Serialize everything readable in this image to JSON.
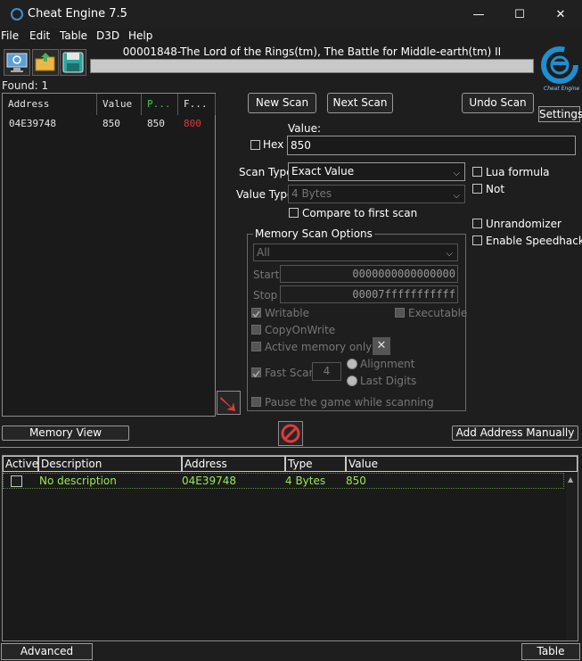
{
  "window": {
    "title": "Cheat Engine 7.5",
    "minimize_glyph": "—",
    "maximize_glyph": "☐",
    "close_glyph": "✕"
  },
  "menu": [
    "File",
    "Edit",
    "Table",
    "D3D",
    "Help"
  ],
  "process_title": "00001848-The Lord of the Rings(tm), The Battle for Middle-earth(tm) II",
  "found_label": "Found: 1",
  "results": {
    "headers": [
      "Address",
      "Value",
      "P...",
      "F..."
    ],
    "rows": [
      {
        "address": "04E39748",
        "value": "850",
        "previous": "850",
        "first": "800"
      }
    ]
  },
  "buttons": {
    "new_scan": "New Scan",
    "next_scan": "Next Scan",
    "undo_scan": "Undo Scan",
    "settings": "Settings",
    "memory_view": "Memory View",
    "add_address": "Add Address Manually",
    "advanced_options": "Advanced Options",
    "table_extras": "Table Extras"
  },
  "scan": {
    "value_label": "Value:",
    "hex_label": "Hex",
    "value": "850",
    "scan_type_label": "Scan Type",
    "scan_type": "Exact Value",
    "value_type_label": "Value Type",
    "value_type": "4 Bytes",
    "compare_first": "Compare to first scan",
    "lua_formula": "Lua formula",
    "not_label": "Not",
    "unrandomizer": "Unrandomizer",
    "speedhack": "Enable Speedhack"
  },
  "memory_options": {
    "title": "Memory Scan Options",
    "region": "All",
    "start_label": "Start",
    "start": "0000000000000000",
    "stop_label": "Stop",
    "stop": "00007fffffffffff",
    "writable": "Writable",
    "executable": "Executable",
    "copy_on_write": "CopyOnWrite",
    "active_memory": "Active memory only",
    "fast_scan": "Fast Scan",
    "fast_scan_value": "4",
    "alignment": "Alignment",
    "last_digits": "Last Digits",
    "pause_game": "Pause the game while scanning"
  },
  "address_list": {
    "headers": [
      "Active",
      "Description",
      "Address",
      "Type",
      "Value"
    ],
    "rows": [
      {
        "description": "No description",
        "address": "04E39748",
        "type": "4 Bytes",
        "value": "850"
      }
    ]
  },
  "logo_text": "Cheat Engine",
  "colors": {
    "accent": "#1e8fd0",
    "found_text": "#9be65a",
    "changed_value": "#e03a3a",
    "stop_icon": "#e03a3a"
  }
}
